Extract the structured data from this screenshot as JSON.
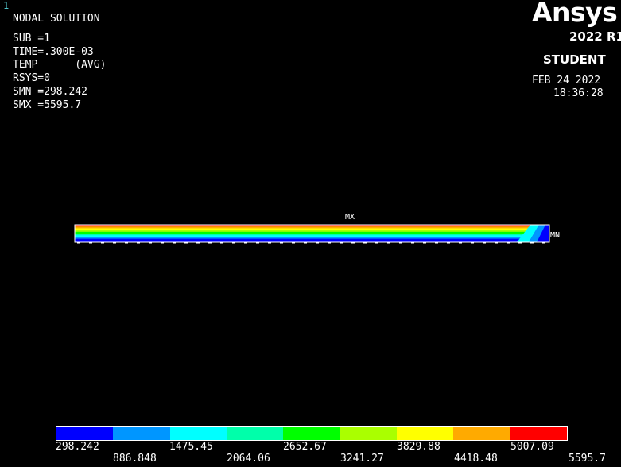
{
  "window_number": "1",
  "info": {
    "title": "NODAL SOLUTION",
    "sub": "SUB =1",
    "time": "TIME=.300E-03",
    "quantity": "TEMP      (AVG)",
    "rsys": "RSYS=0",
    "smn": "SMN =298.242",
    "smx": "SMX =5595.7"
  },
  "brand": {
    "name": "Ansys",
    "release": "2022 R1",
    "edition": "STUDENT"
  },
  "timestamp": {
    "date": "FEB 24 2022",
    "time": "18:36:28"
  },
  "markers": {
    "max": "MX",
    "min": "MN"
  },
  "colors": {
    "background": "#000000",
    "contour": [
      "#0000ff",
      "#0096ff",
      "#00ffff",
      "#00ffaa",
      "#00ff00",
      "#aaff00",
      "#ffff00",
      "#ffaa00",
      "#ff0000"
    ]
  },
  "legend": {
    "values": [
      "298.242",
      "886.848",
      "1475.45",
      "2064.06",
      "2652.67",
      "3241.27",
      "3829.88",
      "4418.48",
      "5007.09",
      "5595.7"
    ]
  }
}
